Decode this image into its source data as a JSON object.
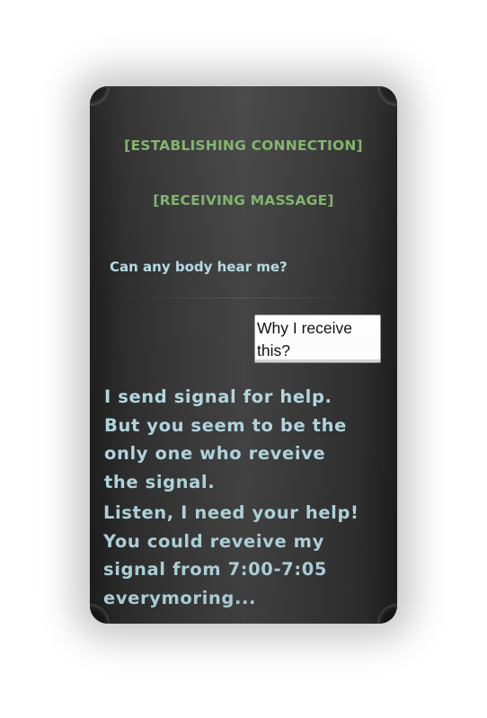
{
  "screen": {
    "status_lines": [
      "[ESTABLISHING CONNECTION]",
      "[RECEIVING MASSAGE]"
    ],
    "incoming_question": "Can any body hear me?",
    "reply_option": "Why I receive this?",
    "messages": [
      "I send signal for help.\nBut you seem to be the\nonly one who reveive\nthe signal.",
      "Listen, I need your help!\nYou could reveive my\nsignal from 7:00-7:05\neverymoring..."
    ]
  },
  "colors": {
    "status_text": "#7fb36b",
    "message_text": "#b6dbe4",
    "panel_dark": "#1e1e1e",
    "panel_light": "#444444"
  }
}
